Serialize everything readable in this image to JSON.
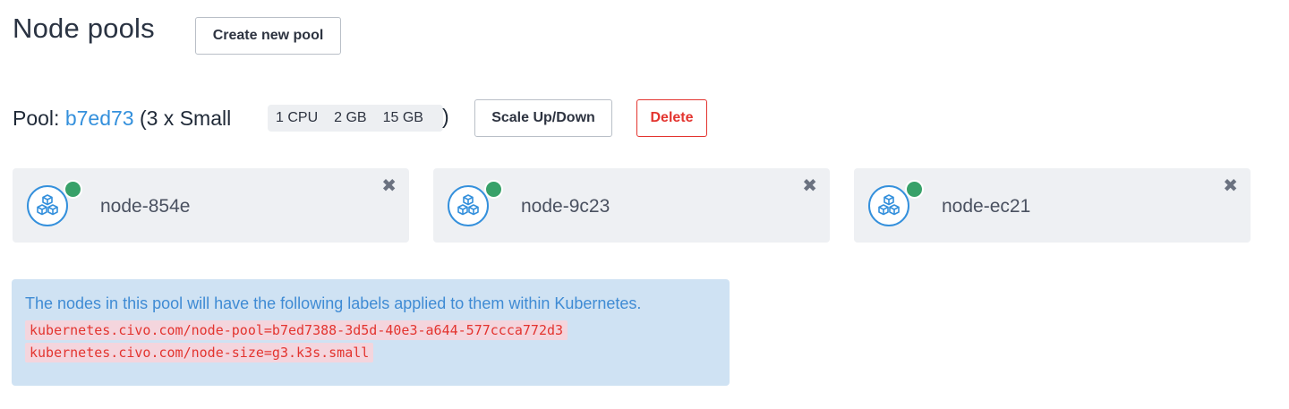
{
  "header": {
    "title": "Node pools",
    "create_button": "Create new pool"
  },
  "pool": {
    "prefix": "Pool:",
    "id": "b7ed73",
    "size_text": "(3 x Small",
    "specs": [
      "1 CPU",
      "2 GB",
      "15 GB"
    ],
    "close": ")",
    "scale_button": "Scale Up/Down",
    "delete_button": "Delete"
  },
  "nodes": [
    {
      "name": "node-854e",
      "status": "running",
      "remove": "✖"
    },
    {
      "name": "node-9c23",
      "status": "running",
      "remove": "✖"
    },
    {
      "name": "node-ec21",
      "status": "running",
      "remove": "✖"
    }
  ],
  "labels_info": {
    "intro": "The nodes in this pool will have the following labels applied to them within Kubernetes.",
    "labels": [
      "kubernetes.civo.com/node-pool=b7ed7388-3d5d-40e3-a644-577ccca772d3",
      "kubernetes.civo.com/node-size=g3.k3s.small"
    ]
  },
  "colors": {
    "accent": "#3490dc",
    "danger": "#e3342f",
    "status_ok": "#38a169",
    "info_bg": "#cfe2f3"
  },
  "icons": {
    "node": "cubes-icon",
    "remove": "close-icon"
  }
}
